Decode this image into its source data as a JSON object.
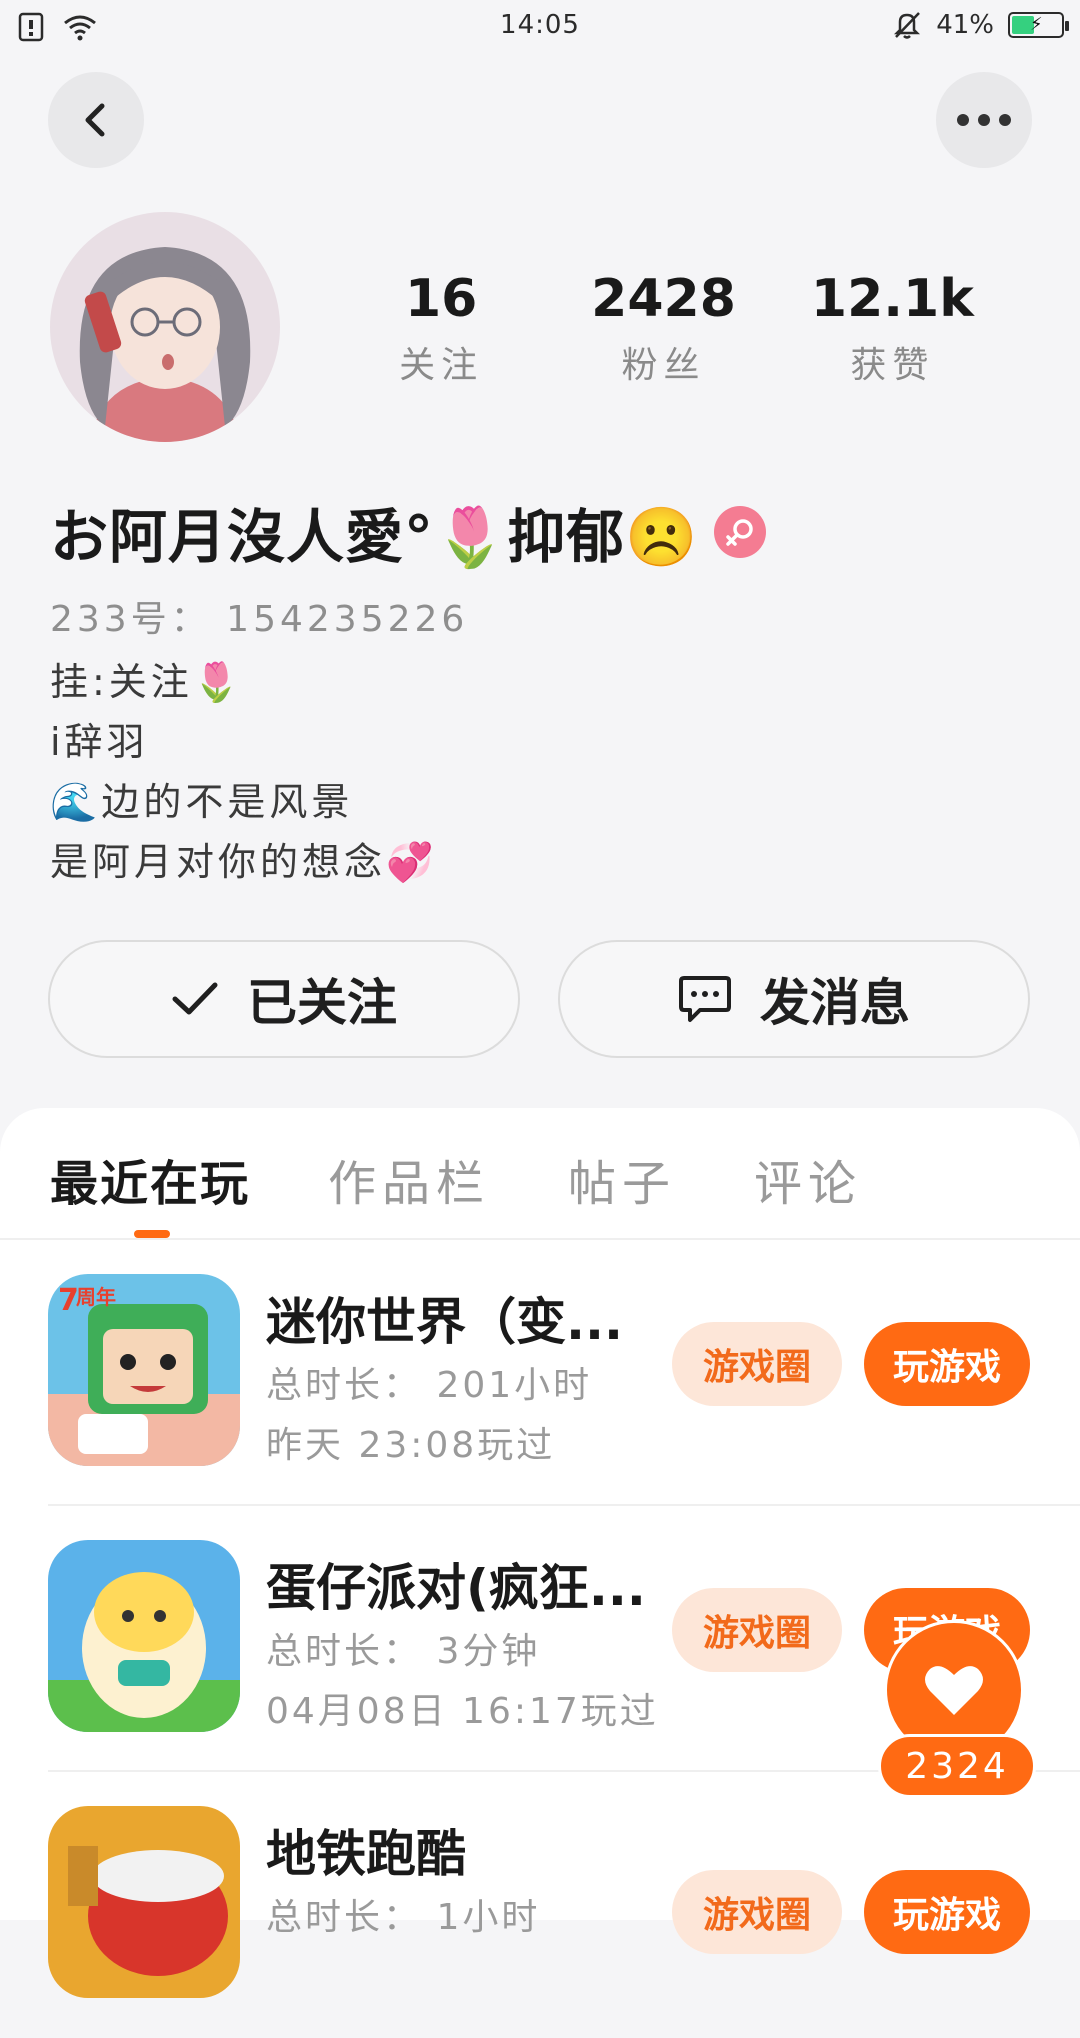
{
  "status_bar": {
    "time": "14:05",
    "battery": "41%"
  },
  "profile": {
    "stats": [
      {
        "value": "16",
        "label": "关注"
      },
      {
        "value": "2428",
        "label": "粉丝"
      },
      {
        "value": "12.1k",
        "label": "获赞"
      }
    ],
    "nickname": "お阿月沒人愛°🌷抑郁☹️",
    "user_id_label": "233号：",
    "user_id": "154235226",
    "bio_lines": [
      "挂:关注🌷",
      "i辞羽",
      "🌊边的不是风景",
      "是阿月对你的想念💞"
    ]
  },
  "actions": {
    "follow_label": "已关注",
    "message_label": "发消息"
  },
  "tabs": [
    "最近在玩",
    "作品栏",
    "帖子",
    "评论"
  ],
  "games": [
    {
      "name": "迷你世界（变...",
      "duration": "总时长： 201小时",
      "last_played": "昨天 23:08玩过",
      "circle_label": "游戏圈",
      "play_label": "玩游戏"
    },
    {
      "name": "蛋仔派对(疯狂...",
      "duration": "总时长： 3分钟",
      "last_played": "04月08日 16:17玩过",
      "circle_label": "游戏圈",
      "play_label": "玩游戏"
    },
    {
      "name": "地铁跑酷",
      "duration": "总时长： 1小时",
      "last_played": "",
      "circle_label": "游戏圈",
      "play_label": "玩游戏"
    }
  ],
  "float_like": {
    "count": "2324"
  },
  "colors": {
    "accent": "#ff6a13",
    "accent_soft": "#fde6d8",
    "gender_badge": "#f47c92"
  }
}
